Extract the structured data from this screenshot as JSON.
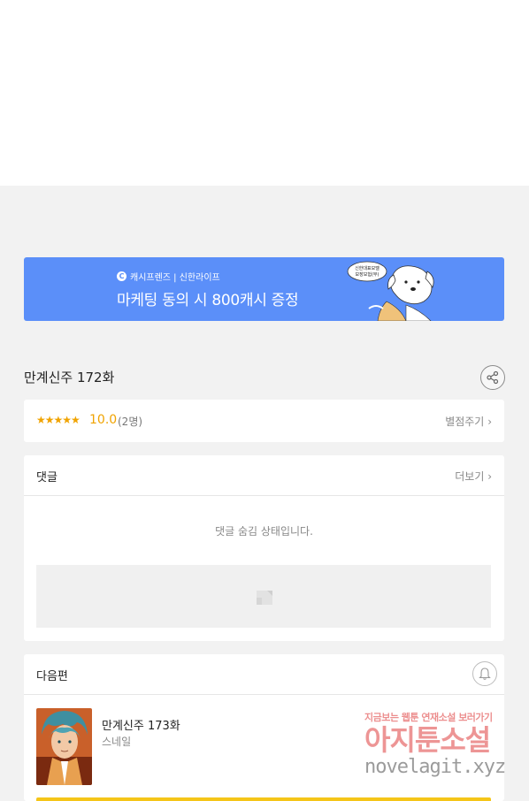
{
  "banner": {
    "brand_logo": "C",
    "brand_text": "캐시프렌즈 | 신한라이프",
    "promo_text": "마케팅 동의 시 800캐시 증정",
    "bubble_line1": "신한대표모델",
    "bubble_line2": "보장보험(무)",
    "bg_color": "#5b8ff9"
  },
  "episode": {
    "title": "만계신주 172화",
    "share_icon": "share-icon"
  },
  "rating": {
    "stars": "★★★★★",
    "value": "10.0",
    "count": "(2명)",
    "rate_link": "별점주기",
    "star_color": "#f0a300"
  },
  "comments": {
    "heading": "댓글",
    "more_link": "더보기",
    "hidden_message": "댓글 숨김 상태입니다."
  },
  "next_episode": {
    "heading": "다음편",
    "bell_icon": "bell-icon",
    "title": "만계신주 173화",
    "author": "스네일"
  },
  "watermark": {
    "line1": "지금보는 웹툰 연재소설 보러가기",
    "line2": "아지툰소설",
    "line3": "novelagit.xyz"
  }
}
